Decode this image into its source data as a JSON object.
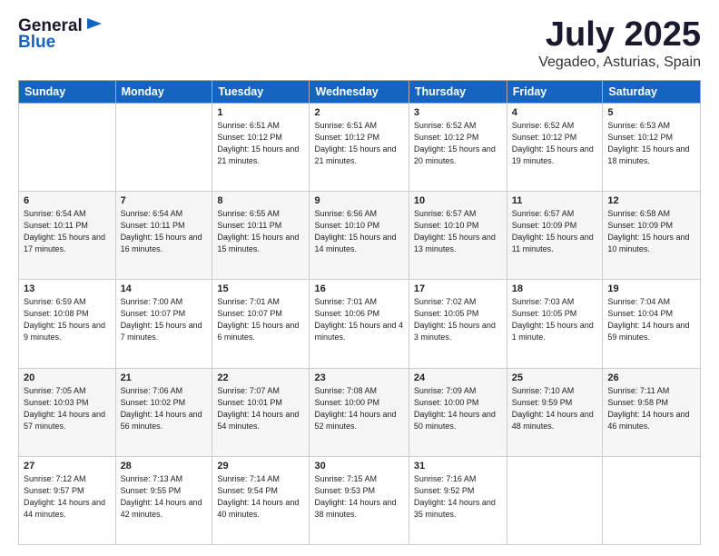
{
  "logo": {
    "general": "General",
    "blue": "Blue"
  },
  "header": {
    "month": "July 2025",
    "location": "Vegadeo, Asturias, Spain"
  },
  "weekdays": [
    "Sunday",
    "Monday",
    "Tuesday",
    "Wednesday",
    "Thursday",
    "Friday",
    "Saturday"
  ],
  "weeks": [
    [
      {
        "day": "",
        "sunrise": "",
        "sunset": "",
        "daylight": ""
      },
      {
        "day": "",
        "sunrise": "",
        "sunset": "",
        "daylight": ""
      },
      {
        "day": "1",
        "sunrise": "Sunrise: 6:51 AM",
        "sunset": "Sunset: 10:12 PM",
        "daylight": "Daylight: 15 hours and 21 minutes."
      },
      {
        "day": "2",
        "sunrise": "Sunrise: 6:51 AM",
        "sunset": "Sunset: 10:12 PM",
        "daylight": "Daylight: 15 hours and 21 minutes."
      },
      {
        "day": "3",
        "sunrise": "Sunrise: 6:52 AM",
        "sunset": "Sunset: 10:12 PM",
        "daylight": "Daylight: 15 hours and 20 minutes."
      },
      {
        "day": "4",
        "sunrise": "Sunrise: 6:52 AM",
        "sunset": "Sunset: 10:12 PM",
        "daylight": "Daylight: 15 hours and 19 minutes."
      },
      {
        "day": "5",
        "sunrise": "Sunrise: 6:53 AM",
        "sunset": "Sunset: 10:12 PM",
        "daylight": "Daylight: 15 hours and 18 minutes."
      }
    ],
    [
      {
        "day": "6",
        "sunrise": "Sunrise: 6:54 AM",
        "sunset": "Sunset: 10:11 PM",
        "daylight": "Daylight: 15 hours and 17 minutes."
      },
      {
        "day": "7",
        "sunrise": "Sunrise: 6:54 AM",
        "sunset": "Sunset: 10:11 PM",
        "daylight": "Daylight: 15 hours and 16 minutes."
      },
      {
        "day": "8",
        "sunrise": "Sunrise: 6:55 AM",
        "sunset": "Sunset: 10:11 PM",
        "daylight": "Daylight: 15 hours and 15 minutes."
      },
      {
        "day": "9",
        "sunrise": "Sunrise: 6:56 AM",
        "sunset": "Sunset: 10:10 PM",
        "daylight": "Daylight: 15 hours and 14 minutes."
      },
      {
        "day": "10",
        "sunrise": "Sunrise: 6:57 AM",
        "sunset": "Sunset: 10:10 PM",
        "daylight": "Daylight: 15 hours and 13 minutes."
      },
      {
        "day": "11",
        "sunrise": "Sunrise: 6:57 AM",
        "sunset": "Sunset: 10:09 PM",
        "daylight": "Daylight: 15 hours and 11 minutes."
      },
      {
        "day": "12",
        "sunrise": "Sunrise: 6:58 AM",
        "sunset": "Sunset: 10:09 PM",
        "daylight": "Daylight: 15 hours and 10 minutes."
      }
    ],
    [
      {
        "day": "13",
        "sunrise": "Sunrise: 6:59 AM",
        "sunset": "Sunset: 10:08 PM",
        "daylight": "Daylight: 15 hours and 9 minutes."
      },
      {
        "day": "14",
        "sunrise": "Sunrise: 7:00 AM",
        "sunset": "Sunset: 10:07 PM",
        "daylight": "Daylight: 15 hours and 7 minutes."
      },
      {
        "day": "15",
        "sunrise": "Sunrise: 7:01 AM",
        "sunset": "Sunset: 10:07 PM",
        "daylight": "Daylight: 15 hours and 6 minutes."
      },
      {
        "day": "16",
        "sunrise": "Sunrise: 7:01 AM",
        "sunset": "Sunset: 10:06 PM",
        "daylight": "Daylight: 15 hours and 4 minutes."
      },
      {
        "day": "17",
        "sunrise": "Sunrise: 7:02 AM",
        "sunset": "Sunset: 10:05 PM",
        "daylight": "Daylight: 15 hours and 3 minutes."
      },
      {
        "day": "18",
        "sunrise": "Sunrise: 7:03 AM",
        "sunset": "Sunset: 10:05 PM",
        "daylight": "Daylight: 15 hours and 1 minute."
      },
      {
        "day": "19",
        "sunrise": "Sunrise: 7:04 AM",
        "sunset": "Sunset: 10:04 PM",
        "daylight": "Daylight: 14 hours and 59 minutes."
      }
    ],
    [
      {
        "day": "20",
        "sunrise": "Sunrise: 7:05 AM",
        "sunset": "Sunset: 10:03 PM",
        "daylight": "Daylight: 14 hours and 57 minutes."
      },
      {
        "day": "21",
        "sunrise": "Sunrise: 7:06 AM",
        "sunset": "Sunset: 10:02 PM",
        "daylight": "Daylight: 14 hours and 56 minutes."
      },
      {
        "day": "22",
        "sunrise": "Sunrise: 7:07 AM",
        "sunset": "Sunset: 10:01 PM",
        "daylight": "Daylight: 14 hours and 54 minutes."
      },
      {
        "day": "23",
        "sunrise": "Sunrise: 7:08 AM",
        "sunset": "Sunset: 10:00 PM",
        "daylight": "Daylight: 14 hours and 52 minutes."
      },
      {
        "day": "24",
        "sunrise": "Sunrise: 7:09 AM",
        "sunset": "Sunset: 10:00 PM",
        "daylight": "Daylight: 14 hours and 50 minutes."
      },
      {
        "day": "25",
        "sunrise": "Sunrise: 7:10 AM",
        "sunset": "Sunset: 9:59 PM",
        "daylight": "Daylight: 14 hours and 48 minutes."
      },
      {
        "day": "26",
        "sunrise": "Sunrise: 7:11 AM",
        "sunset": "Sunset: 9:58 PM",
        "daylight": "Daylight: 14 hours and 46 minutes."
      }
    ],
    [
      {
        "day": "27",
        "sunrise": "Sunrise: 7:12 AM",
        "sunset": "Sunset: 9:57 PM",
        "daylight": "Daylight: 14 hours and 44 minutes."
      },
      {
        "day": "28",
        "sunrise": "Sunrise: 7:13 AM",
        "sunset": "Sunset: 9:55 PM",
        "daylight": "Daylight: 14 hours and 42 minutes."
      },
      {
        "day": "29",
        "sunrise": "Sunrise: 7:14 AM",
        "sunset": "Sunset: 9:54 PM",
        "daylight": "Daylight: 14 hours and 40 minutes."
      },
      {
        "day": "30",
        "sunrise": "Sunrise: 7:15 AM",
        "sunset": "Sunset: 9:53 PM",
        "daylight": "Daylight: 14 hours and 38 minutes."
      },
      {
        "day": "31",
        "sunrise": "Sunrise: 7:16 AM",
        "sunset": "Sunset: 9:52 PM",
        "daylight": "Daylight: 14 hours and 35 minutes."
      },
      {
        "day": "",
        "sunrise": "",
        "sunset": "",
        "daylight": ""
      },
      {
        "day": "",
        "sunrise": "",
        "sunset": "",
        "daylight": ""
      }
    ]
  ]
}
